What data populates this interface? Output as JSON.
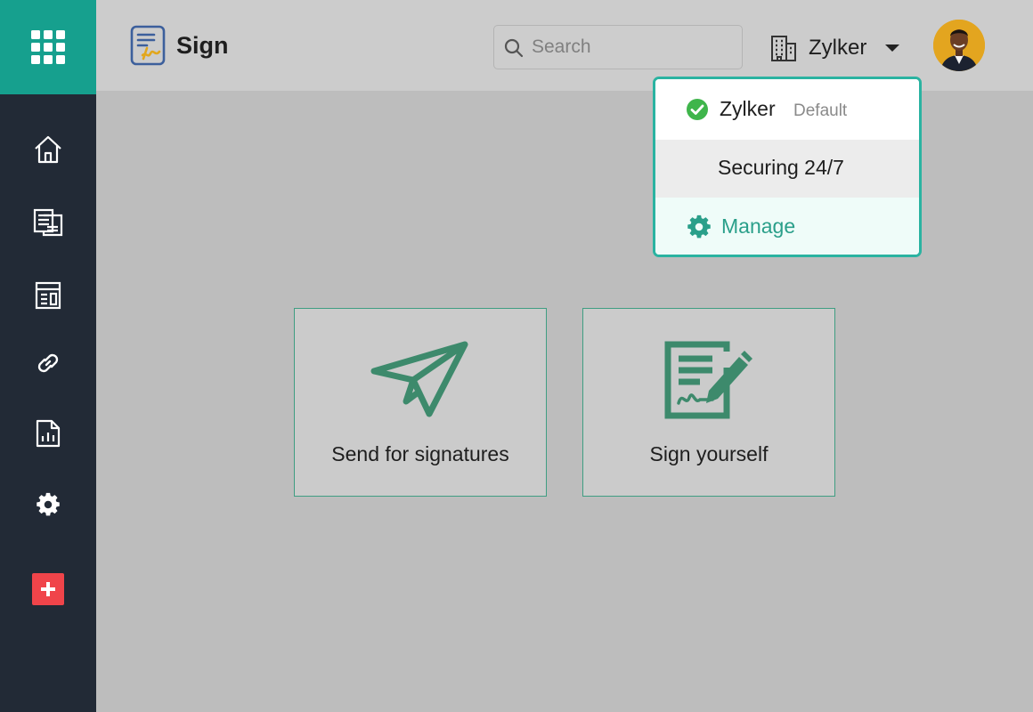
{
  "app": {
    "title": "Sign"
  },
  "sidebar": {
    "items": [
      {
        "icon": "home-icon"
      },
      {
        "icon": "documents-icon"
      },
      {
        "icon": "templates-icon"
      },
      {
        "icon": "link-icon"
      },
      {
        "icon": "reports-icon"
      },
      {
        "icon": "gear-icon"
      }
    ],
    "add_icon": "plus-icon"
  },
  "header": {
    "search": {
      "placeholder": "Search",
      "value": ""
    },
    "org_switch": {
      "label": "Zylker"
    }
  },
  "org_dropdown": {
    "items": [
      {
        "name": "Zylker",
        "badge": "Default",
        "selected": true
      },
      {
        "name": "Securing 24/7",
        "selected": false
      }
    ],
    "manage_label": "Manage"
  },
  "actions": {
    "send": {
      "label": "Send for signatures",
      "icon": "paper-plane-icon"
    },
    "self": {
      "label": "Sign yourself",
      "icon": "sign-document-icon"
    }
  },
  "colors": {
    "sidebar": "#222a36",
    "apps_tile": "#16a08e",
    "accent": "#2ab3a1",
    "card_icon": "#3d8a6c",
    "add_button": "#f0444a",
    "header": "#cccccc",
    "canvas": "#bdbdbd"
  }
}
